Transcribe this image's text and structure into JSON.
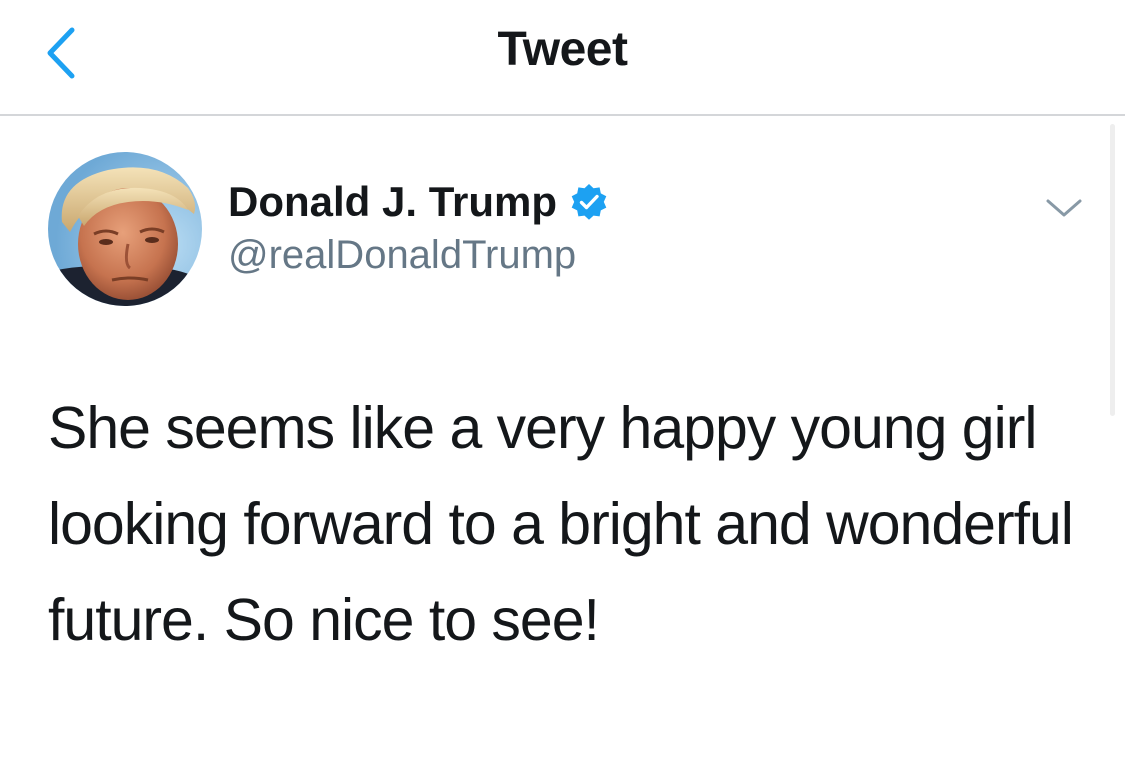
{
  "nav": {
    "title": "Tweet",
    "back_icon": "chevron-left-icon"
  },
  "tweet": {
    "author": {
      "display_name": "Donald J. Trump",
      "handle": "@realDonaldTrump",
      "verified": true,
      "avatar": "profile-photo"
    },
    "text": "She seems like a very happy young girl looking forward to a bright and wonderful future. So nice to see!",
    "menu_icon": "chevron-down-icon"
  },
  "colors": {
    "accent": "#1da1f2",
    "text_primary": "#14171a",
    "text_secondary": "#657786",
    "divider": "#d4d6d9",
    "background": "#ffffff"
  }
}
